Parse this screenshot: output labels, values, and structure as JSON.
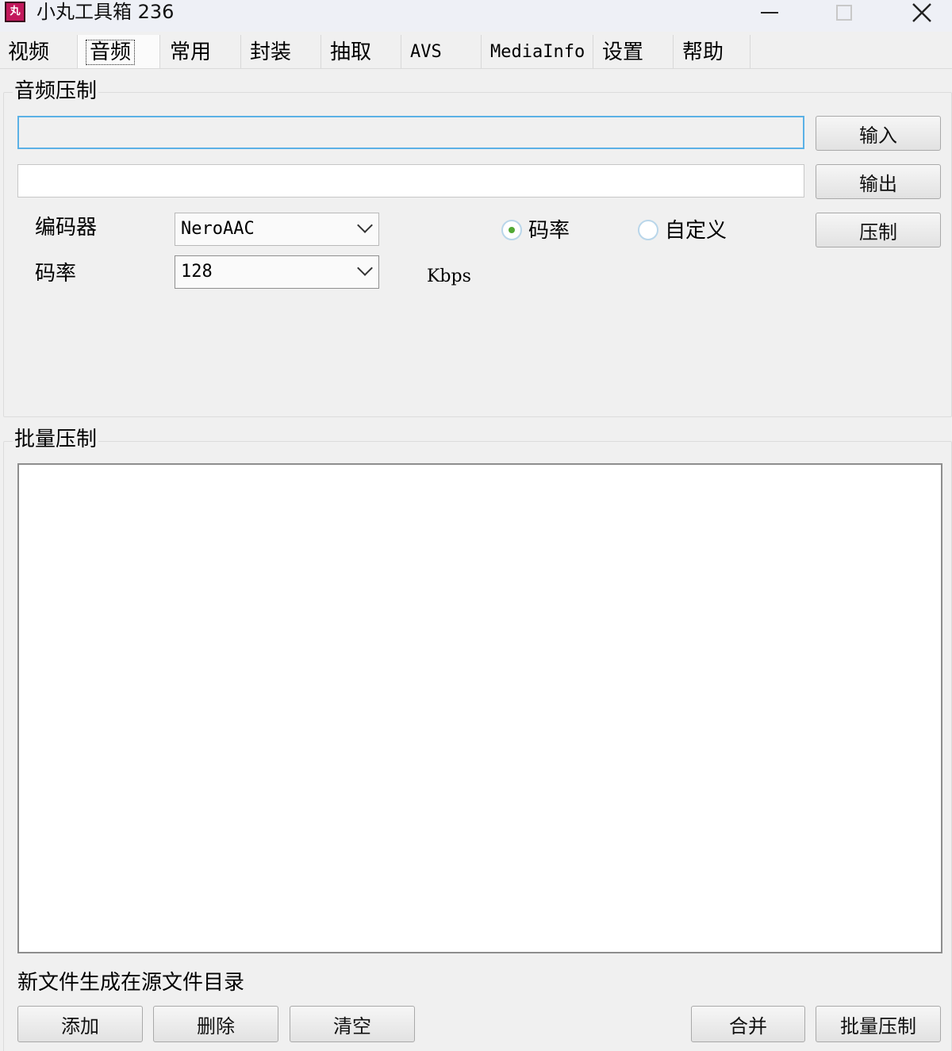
{
  "window": {
    "icon_text": "丸",
    "title": "小丸工具箱 236"
  },
  "tabs": [
    {
      "label": "视频"
    },
    {
      "label": "音频"
    },
    {
      "label": "常用"
    },
    {
      "label": "封装"
    },
    {
      "label": "抽取"
    },
    {
      "label": "AVS"
    },
    {
      "label": "MediaInfo"
    },
    {
      "label": "设置"
    },
    {
      "label": "帮助"
    }
  ],
  "active_tab": "音频",
  "audio_encode": {
    "group_title": "音频压制",
    "input_path": "",
    "output_path": "",
    "input_button": "输入",
    "output_button": "输出",
    "encode_button": "压制",
    "encoder_label": "编码器",
    "encoder_value": "NeroAAC",
    "bitrate_label": "码率",
    "bitrate_value": "128",
    "bitrate_unit": "Kbps",
    "mode_options": [
      "码率",
      "自定义"
    ],
    "mode_selected": "码率"
  },
  "batch_encode": {
    "group_title": "批量压制",
    "files": [],
    "output_note": "新文件生成在源文件目录",
    "add_button": "添加",
    "delete_button": "删除",
    "clear_button": "清空",
    "merge_button": "合并",
    "batch_encode_button": "批量压制"
  },
  "colors": {
    "accent_border": "#5bb1e6",
    "radio_selected": "#52a935",
    "app_icon": "#c2185b"
  }
}
